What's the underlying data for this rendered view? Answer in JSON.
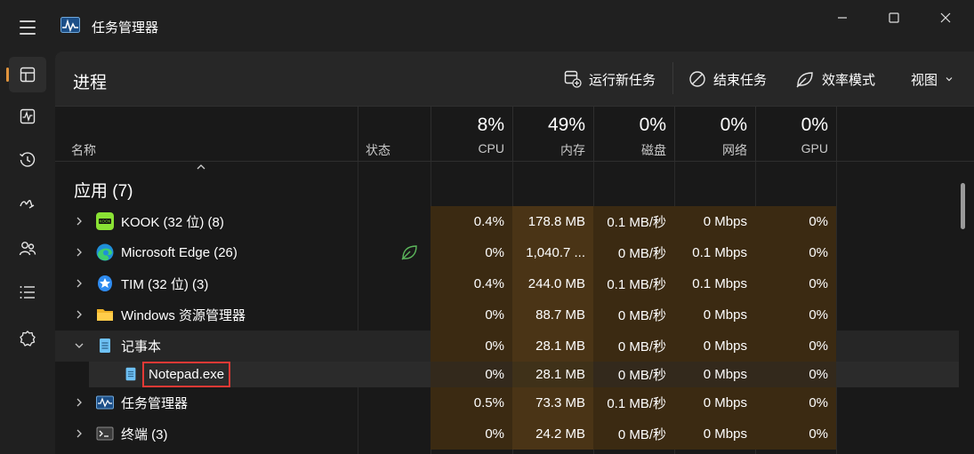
{
  "window": {
    "title": "任务管理器",
    "minimize_icon": "minimize-icon",
    "maximize_icon": "maximize-icon",
    "close_icon": "close-icon"
  },
  "nav": {
    "items": [
      {
        "icon": "processes-icon",
        "active": true
      },
      {
        "icon": "performance-icon",
        "active": false
      },
      {
        "icon": "app-history-icon",
        "active": false
      },
      {
        "icon": "startup-apps-icon",
        "active": false
      },
      {
        "icon": "users-icon",
        "active": false
      },
      {
        "icon": "details-icon",
        "active": false
      },
      {
        "icon": "services-icon",
        "active": false
      }
    ]
  },
  "header": {
    "page_title": "进程",
    "run_new_task": "运行新任务",
    "end_task": "结束任务",
    "efficiency_mode": "效率模式",
    "view": "视图"
  },
  "columns": {
    "name": "名称",
    "status": "状态",
    "cpu": {
      "pct": "8%",
      "label": "CPU"
    },
    "memory": {
      "pct": "49%",
      "label": "内存"
    },
    "disk": {
      "pct": "0%",
      "label": "磁盘"
    },
    "network": {
      "pct": "0%",
      "label": "网络"
    },
    "gpu": {
      "pct": "0%",
      "label": "GPU"
    }
  },
  "group": {
    "title": "应用 (7)"
  },
  "rows": [
    {
      "name": "KOOK (32 位) (8)",
      "icon": "kook-icon",
      "cpu": "0.4%",
      "mem": "178.8 MB",
      "disk": "0.1 MB/秒",
      "net": "0 Mbps",
      "gpu": "0%"
    },
    {
      "name": "Microsoft Edge (26)",
      "icon": "edge-icon",
      "status_icon": "efficiency-leaf-icon",
      "cpu": "0%",
      "mem": "1,040.7 ...",
      "disk": "0 MB/秒",
      "net": "0.1 Mbps",
      "gpu": "0%"
    },
    {
      "name": "TIM (32 位) (3)",
      "icon": "tim-icon",
      "cpu": "0.4%",
      "mem": "244.0 MB",
      "disk": "0.1 MB/秒",
      "net": "0.1 Mbps",
      "gpu": "0%"
    },
    {
      "name": "Windows 资源管理器",
      "icon": "folder-icon",
      "cpu": "0%",
      "mem": "88.7 MB",
      "disk": "0 MB/秒",
      "net": "0 Mbps",
      "gpu": "0%"
    },
    {
      "name": "记事本",
      "icon": "notepad-icon",
      "cpu": "0%",
      "mem": "28.1 MB",
      "disk": "0 MB/秒",
      "net": "0 Mbps",
      "gpu": "0%"
    },
    {
      "name": "Notepad.exe",
      "icon": "notepad-icon",
      "cpu": "0%",
      "mem": "28.1 MB",
      "disk": "0 MB/秒",
      "net": "0 Mbps",
      "gpu": "0%"
    },
    {
      "name": "任务管理器",
      "icon": "task-manager-icon",
      "cpu": "0.5%",
      "mem": "73.3 MB",
      "disk": "0.1 MB/秒",
      "net": "0 Mbps",
      "gpu": "0%"
    },
    {
      "name": "终端 (3)",
      "icon": "terminal-icon",
      "cpu": "0%",
      "mem": "24.2 MB",
      "disk": "0 MB/秒",
      "net": "0 Mbps",
      "gpu": "0%"
    }
  ],
  "colors": {
    "accent": "#e0933c",
    "highlight_border": "#e53935",
    "heat_low": "#3b2a12",
    "heat_mid": "#4a3416"
  }
}
